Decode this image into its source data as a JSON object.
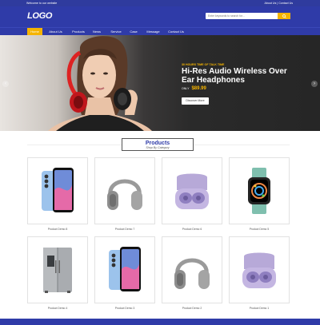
{
  "topbar": {
    "welcome": "Welcome to our website",
    "links": "About Us | Contact Us"
  },
  "header": {
    "logo": "LOGO",
    "search_placeholder": "Enter keywords to search for..."
  },
  "nav": [
    {
      "label": "Home",
      "active": true
    },
    {
      "label": "About Us"
    },
    {
      "label": "Products"
    },
    {
      "label": "News"
    },
    {
      "label": "Service"
    },
    {
      "label": "Case"
    },
    {
      "label": "Message"
    },
    {
      "label": "Contact Us"
    }
  ],
  "hero": {
    "subtitle": "30 HOURS TIME OF TALK TIME",
    "title": "Hi-Res Audio Wireless Over Ear Headphones",
    "price_prefix": "ONLY",
    "price": "$89.99",
    "button": "Discover More",
    "slides": 2,
    "active_slide": 2
  },
  "products_section": {
    "title": "Products",
    "subtitle": "Shop By Category"
  },
  "products": [
    {
      "name": "Product Demo 8",
      "type": "phone"
    },
    {
      "name": "Product Demo 7",
      "type": "headphones"
    },
    {
      "name": "Product Demo 6",
      "type": "earbuds"
    },
    {
      "name": "Product Demo 5",
      "type": "watch"
    },
    {
      "name": "Product Demo 4",
      "type": "fridge"
    },
    {
      "name": "Product Demo 3",
      "type": "phone"
    },
    {
      "name": "Product Demo 2",
      "type": "headphones"
    },
    {
      "name": "Product Demo 1",
      "type": "earbuds"
    }
  ],
  "colors": {
    "primary": "#2f3ba8",
    "accent": "#f5b400"
  }
}
